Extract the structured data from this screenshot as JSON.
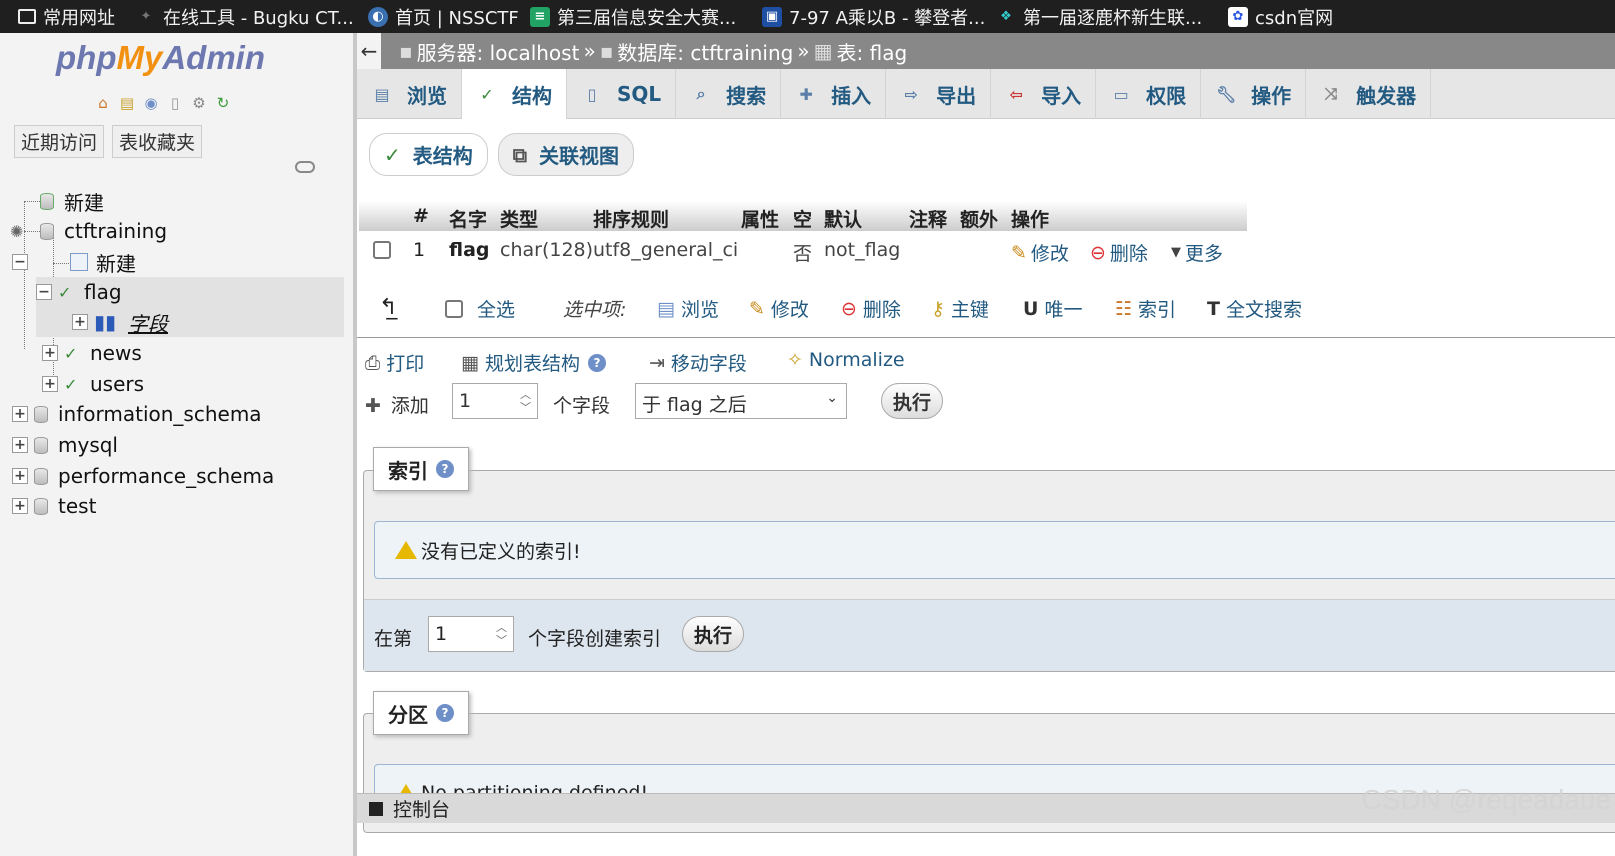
{
  "bookmarks": [
    {
      "label": "常用网址",
      "icon": "folder-icon"
    },
    {
      "label": "在线工具 - Bugku CT...",
      "icon": "bugku-icon"
    },
    {
      "label": "首页 | NSSCTF",
      "icon": "nssctf-icon"
    },
    {
      "label": "第三届信息安全大赛...",
      "icon": "sheet-icon"
    },
    {
      "label": "7-97 A乘以B - 攀登者...",
      "icon": "pta-icon"
    },
    {
      "label": "第一届逐鹿杯新生联...",
      "icon": "leaf-icon"
    },
    {
      "label": "csdn官网",
      "icon": "baidu-paw-icon"
    }
  ],
  "sidebar": {
    "logo": {
      "php": "php",
      "my": "My",
      "admin": "Admin"
    },
    "tabs": [
      "近期访问",
      "表收藏夹"
    ],
    "tree": {
      "new_root": "新建",
      "db_ctftraining": "ctftraining",
      "new_table": "新建",
      "table_flag": "flag",
      "columns": "字段",
      "table_news": "news",
      "table_users": "users",
      "db_information_schema": "information_schema",
      "db_mysql": "mysql",
      "db_performance_schema": "performance_schema",
      "db_test": "test"
    }
  },
  "breadcrumb": {
    "server": "服务器: localhost",
    "sep1": "»",
    "database": "数据库: ctftraining",
    "sep2": "»",
    "table": "表: flag"
  },
  "tabs": [
    "浏览",
    "结构",
    "SQL",
    "搜索",
    "插入",
    "导出",
    "导入",
    "权限",
    "操作",
    "触发器"
  ],
  "subtabs": [
    "表结构",
    "关联视图"
  ],
  "table": {
    "headers": [
      "#",
      "名字",
      "类型",
      "排序规则",
      "属性",
      "空",
      "默认",
      "注释",
      "额外",
      "操作"
    ],
    "row": {
      "num": "1",
      "name": "flag",
      "type": "char(128)",
      "collation": "utf8_general_ci",
      "attr": "",
      "null": "否",
      "default": "not_flag",
      "comment": "",
      "extra": "",
      "actions": {
        "edit": "修改",
        "drop": "删除",
        "more": "更多"
      }
    }
  },
  "bulk": {
    "select_all": "全选",
    "with_selected": "选中项:",
    "browse": "浏览",
    "edit": "修改",
    "drop": "删除",
    "primary": "主键",
    "unique": "唯一",
    "index": "索引",
    "fulltext": "全文搜索"
  },
  "tools": {
    "print": "打印",
    "propose": "规划表结构",
    "move": "移动字段",
    "normalize": "Normalize"
  },
  "add_field": {
    "label_add": "添加",
    "count": "1",
    "label_fields": "个字段",
    "position": "于 flag 之后",
    "go": "执行"
  },
  "indexes": {
    "legend": "索引",
    "notice": "没有已定义的索引!",
    "create_prefix": "在第",
    "count": "1",
    "create_suffix": "个字段创建索引",
    "go": "执行"
  },
  "partitions": {
    "legend": "分区",
    "notice": "No partitioning defined!"
  },
  "console": "控制台",
  "watermark": "CSDN @reqeadaue"
}
